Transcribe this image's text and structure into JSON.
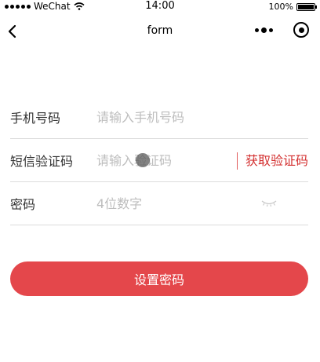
{
  "status_bar": {
    "carrier": "WeChat",
    "time": "14:00",
    "battery": "100%",
    "battery_level": 1.0
  },
  "nav": {
    "title": "form"
  },
  "form": {
    "phone": {
      "label": "手机号码",
      "placeholder": "请输入手机号码"
    },
    "sms": {
      "label": "短信验证码",
      "placeholder": "请输入验证码",
      "button": "获取验证码"
    },
    "password": {
      "label": "密码",
      "placeholder": "4位数字"
    }
  },
  "submit": {
    "label": "设置密码"
  },
  "colors": {
    "accent": "#e4474b",
    "code_button_text": "#d32f2f"
  },
  "icons": {
    "back": "chevron-left-icon",
    "more": "more-dots-icon",
    "home": "target-icon",
    "eye": "eye-closed-icon"
  }
}
